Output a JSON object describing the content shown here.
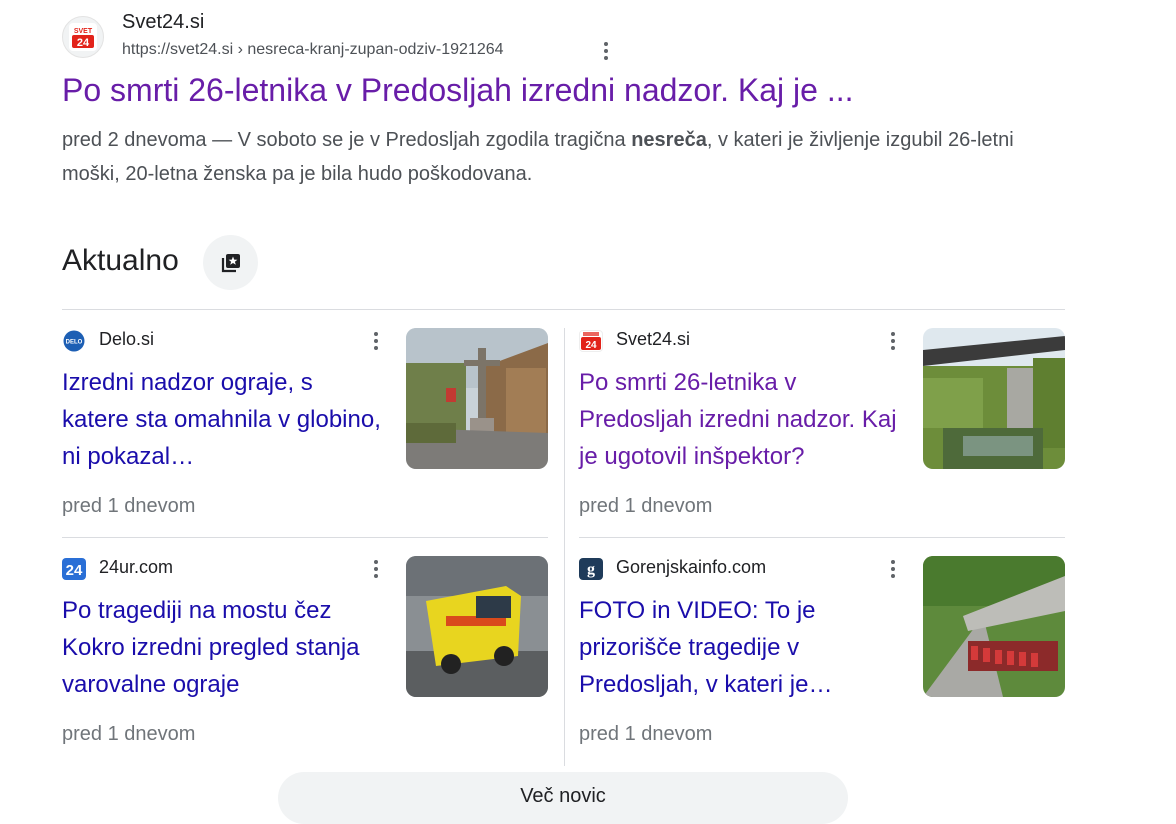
{
  "result": {
    "site_name": "Svet24.si",
    "url": "https://svet24.si › nesreca-kranj-zupan-odziv-1921264",
    "title": "Po smrti 26-letnika v Predosljah izredni nadzor. Kaj je ...",
    "snippet_before": "pred 2 dnevoma — V soboto se je v Predosljah zgodila tragična ",
    "snippet_bold": "nesreča",
    "snippet_after": ", v kateri je življenje izgubil 26-letni moški, 20-letna ženska pa je bila hudo poškodovana.",
    "logo_text_top": "SVET",
    "logo_text_bottom": "24"
  },
  "section": {
    "title": "Aktualno"
  },
  "cards": [
    {
      "source": "Delo.si",
      "icon_text": "DELO",
      "title": "Izredni nadzor ograje, s katere sta omahnila v globino, ni pokazal…",
      "time": "pred 1 dnevom"
    },
    {
      "source": "Svet24.si",
      "icon_text": "24",
      "title": "Po smrti 26-letnika v Predosljah izredni nadzor. Kaj je ugotovil inšpektor?",
      "time": "pred 1 dnevom"
    },
    {
      "source": "24ur.com",
      "icon_text": "24",
      "title": "Po tragediji na mostu čez Kokro izredni pregled stanja varovalne ograje",
      "time": "pred 1 dnevom"
    },
    {
      "source": "Gorenjskainfo.com",
      "icon_text": "g",
      "title": "FOTO in VIDEO: To je prizorišče tragedije v Predosljah, v kateri je…",
      "time": "pred 1 dnevom"
    }
  ],
  "more": {
    "label": "Več novic"
  },
  "colors": {
    "visited_link": "#681da8",
    "link": "#1a0dab",
    "svet24_red": "#e2231a",
    "delo_blue": "#1d5fb4",
    "ur24_blue": "#2a6fd6",
    "gorenjska_navy": "#1f3b5a"
  },
  "icons": [
    "kebab-menu-icon",
    "star-bookmark-icon"
  ]
}
